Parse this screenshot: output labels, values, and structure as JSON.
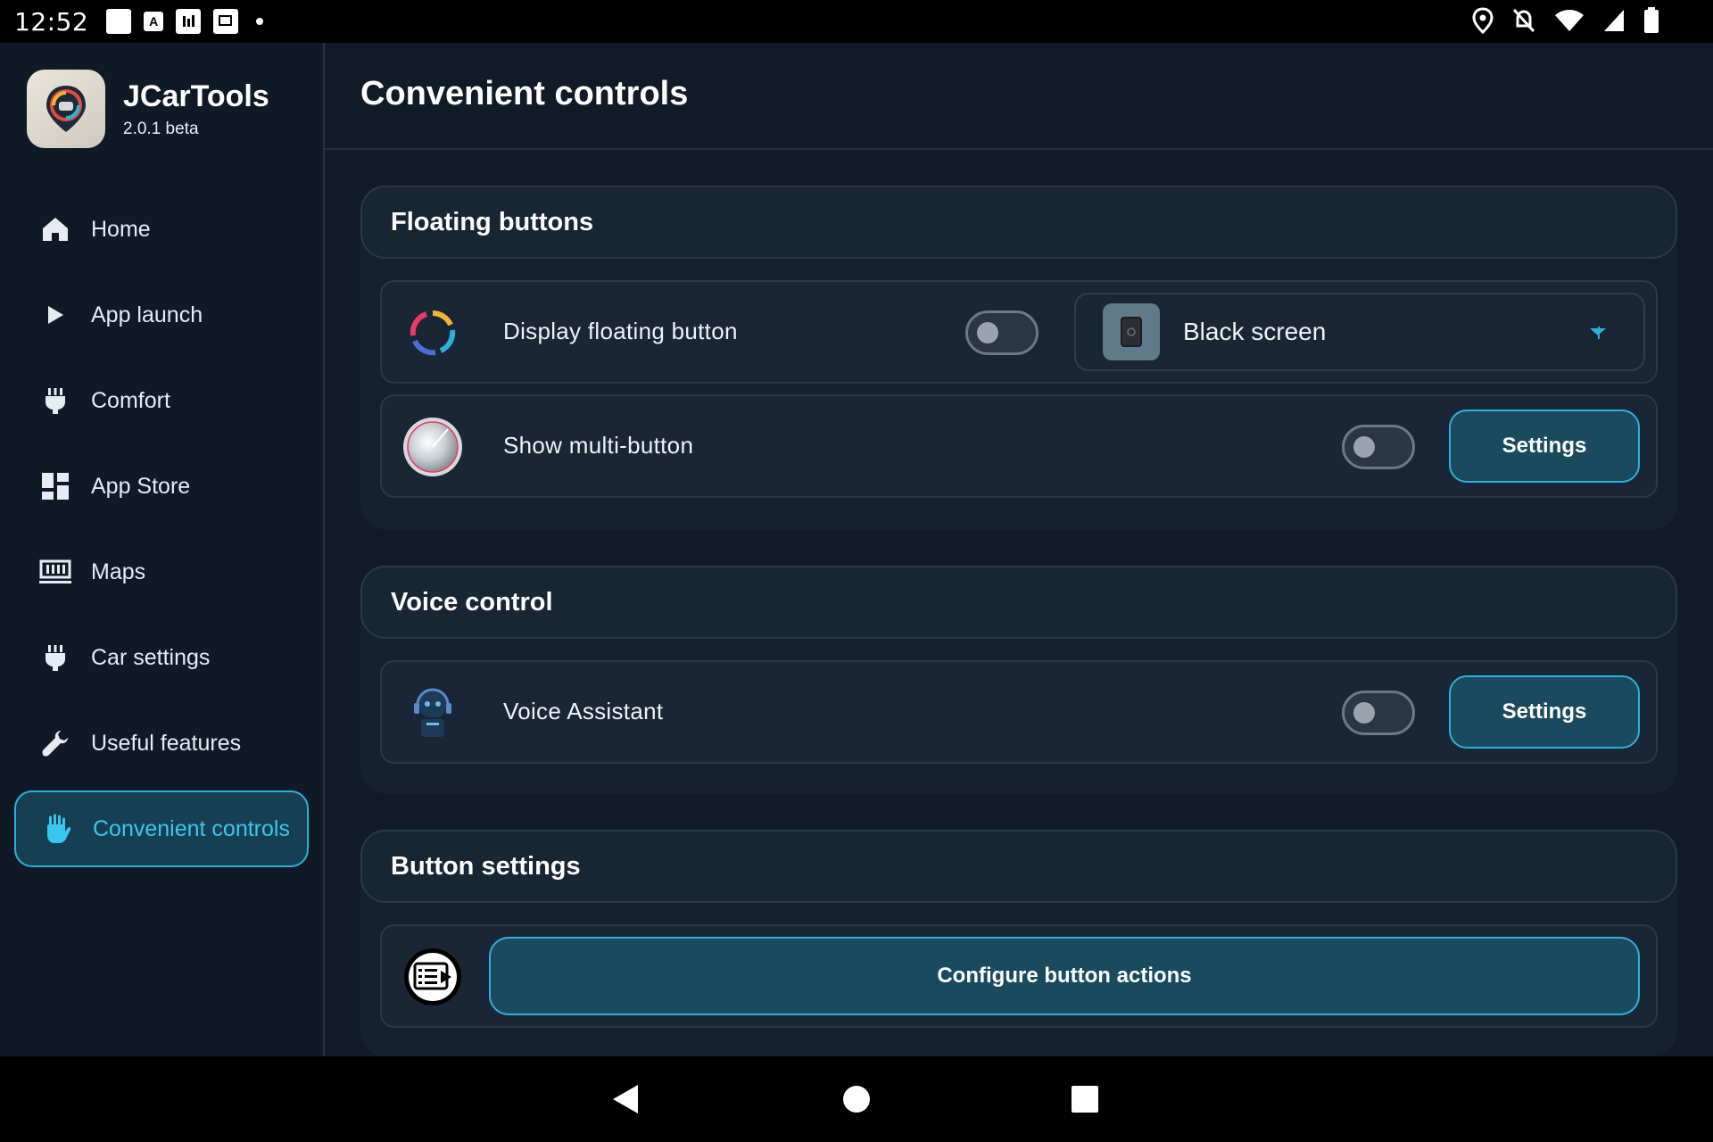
{
  "status_bar": {
    "time": "12:52",
    "notification_icons": [
      "square-icon",
      "a-badge-icon",
      "sim-icon",
      "cast-icon",
      "dot-icon"
    ],
    "system_icons": [
      "location-icon",
      "bell-off-icon",
      "wifi-icon",
      "signal-icon",
      "battery-icon"
    ]
  },
  "app": {
    "name": "JCarTools",
    "version": "2.0.1 beta"
  },
  "sidebar": {
    "items": [
      {
        "label": "Home",
        "icon": "home-icon"
      },
      {
        "label": "App launch",
        "icon": "play-icon"
      },
      {
        "label": "Comfort",
        "icon": "plug-icon"
      },
      {
        "label": "App Store",
        "icon": "dashboard-icon"
      },
      {
        "label": "Maps",
        "icon": "ruler-icon"
      },
      {
        "label": "Car settings",
        "icon": "plug-icon"
      },
      {
        "label": "Useful features",
        "icon": "wrench-icon"
      },
      {
        "label": "Convenient controls",
        "icon": "hand-icon",
        "active": true
      }
    ]
  },
  "page": {
    "title": "Convenient controls"
  },
  "sections": {
    "floating": {
      "title": "Floating buttons",
      "display_floating": {
        "label": "Display floating button",
        "enabled": false
      },
      "dropdown": {
        "value": "Black screen"
      },
      "multi_button": {
        "label": "Show multi-button",
        "enabled": false,
        "button": "Settings"
      }
    },
    "voice": {
      "title": "Voice control",
      "assistant": {
        "label": "Voice Assistant",
        "enabled": false,
        "button": "Settings"
      }
    },
    "button_settings": {
      "title": "Button settings",
      "configure": "Configure button actions"
    }
  },
  "colors": {
    "background": "#101b27",
    "accent": "#2ab3d8",
    "active_text": "#38c7ee",
    "button_fill": "#1a4a5e"
  }
}
